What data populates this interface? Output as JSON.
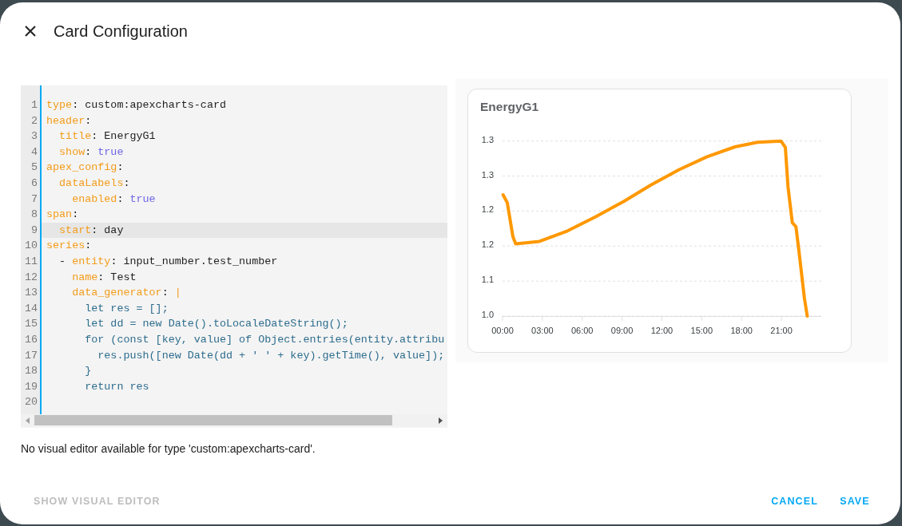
{
  "dialog": {
    "title": "Card Configuration"
  },
  "editor": {
    "lines": [
      {
        "number": "1",
        "active": false,
        "tokens": [
          {
            "kind": "key",
            "text": "type"
          },
          {
            "kind": "plain",
            "text": ": custom:apexcharts-card"
          }
        ]
      },
      {
        "number": "2",
        "active": false,
        "tokens": [
          {
            "kind": "key",
            "text": "header"
          },
          {
            "kind": "plain",
            "text": ":"
          }
        ]
      },
      {
        "number": "3",
        "active": false,
        "tokens": [
          {
            "kind": "key",
            "text": "  title"
          },
          {
            "kind": "plain",
            "text": ": EnergyG1"
          }
        ]
      },
      {
        "number": "4",
        "active": false,
        "tokens": [
          {
            "kind": "key",
            "text": "  show"
          },
          {
            "kind": "plain",
            "text": ": "
          },
          {
            "kind": "bool",
            "text": "true"
          }
        ]
      },
      {
        "number": "5",
        "active": false,
        "tokens": [
          {
            "kind": "key",
            "text": "apex_config"
          },
          {
            "kind": "plain",
            "text": ":"
          }
        ]
      },
      {
        "number": "6",
        "active": false,
        "tokens": [
          {
            "kind": "key",
            "text": "  dataLabels"
          },
          {
            "kind": "plain",
            "text": ":"
          }
        ]
      },
      {
        "number": "7",
        "active": false,
        "tokens": [
          {
            "kind": "key",
            "text": "    enabled"
          },
          {
            "kind": "plain",
            "text": ": "
          },
          {
            "kind": "bool",
            "text": "true"
          }
        ]
      },
      {
        "number": "8",
        "active": false,
        "tokens": [
          {
            "kind": "key",
            "text": "span"
          },
          {
            "kind": "plain",
            "text": ":"
          }
        ]
      },
      {
        "number": "9",
        "active": true,
        "tokens": [
          {
            "kind": "key",
            "text": "  start"
          },
          {
            "kind": "plain",
            "text": ": day"
          }
        ]
      },
      {
        "number": "10",
        "active": false,
        "tokens": [
          {
            "kind": "key",
            "text": "series"
          },
          {
            "kind": "plain",
            "text": ":"
          }
        ]
      },
      {
        "number": "11",
        "active": false,
        "tokens": [
          {
            "kind": "plain",
            "text": "  - "
          },
          {
            "kind": "key",
            "text": "entity"
          },
          {
            "kind": "plain",
            "text": ": input_number.test_number"
          }
        ]
      },
      {
        "number": "12",
        "active": false,
        "tokens": [
          {
            "kind": "key",
            "text": "    name"
          },
          {
            "kind": "plain",
            "text": ": Test"
          }
        ]
      },
      {
        "number": "13",
        "active": false,
        "tokens": [
          {
            "kind": "key",
            "text": "    data_generator"
          },
          {
            "kind": "plain",
            "text": ": "
          },
          {
            "kind": "key",
            "text": "|"
          }
        ]
      },
      {
        "number": "14",
        "active": false,
        "tokens": [
          {
            "kind": "block",
            "text": "      let res = [];"
          }
        ]
      },
      {
        "number": "15",
        "active": false,
        "tokens": [
          {
            "kind": "block",
            "text": "      let dd = new Date().toLocaleDateString();"
          }
        ]
      },
      {
        "number": "16",
        "active": false,
        "tokens": [
          {
            "kind": "block",
            "text": "      for (const [key, value] of Object.entries(entity.attribu"
          }
        ]
      },
      {
        "number": "17",
        "active": false,
        "tokens": [
          {
            "kind": "block",
            "text": "        res.push([new Date(dd + ' ' + key).getTime(), value]);"
          }
        ]
      },
      {
        "number": "18",
        "active": false,
        "tokens": [
          {
            "kind": "block",
            "text": "      }"
          }
        ]
      },
      {
        "number": "19",
        "active": false,
        "tokens": [
          {
            "kind": "block",
            "text": "      return res"
          }
        ]
      },
      {
        "number": "20",
        "active": false
      }
    ]
  },
  "message": "No visual editor available for type 'custom:apexcharts-card'.",
  "preview": {
    "card": {
      "chart_data": {
        "type": "line",
        "title": "EnergyG1",
        "grid": true,
        "x": [
          0.04,
          0.36,
          0.78,
          0.99,
          2.78,
          4.89,
          6.99,
          9.09,
          11.2,
          13.3,
          15.4,
          17.5,
          19.19,
          20.97,
          21.3,
          21.5,
          21.82,
          22.1,
          22.34,
          22.73,
          22.95
        ],
        "series": [
          {
            "color": "#ff9800",
            "values": [
              1.248,
              1.234,
              1.176,
              1.164,
              1.168,
              1.186,
              1.21,
              1.236,
              1.265,
              1.291,
              1.313,
              1.33,
              1.338,
              1.34,
              1.329,
              1.262,
              1.2,
              1.193,
              1.148,
              1.071,
              1.04
            ]
          }
        ],
        "xlim": [
          0,
          24
        ],
        "ylim": [
          1.04,
          1.34
        ],
        "xticks": [
          {
            "value": 0,
            "label": "00:00"
          },
          {
            "value": 3,
            "label": "03:00"
          },
          {
            "value": 6,
            "label": "06:00"
          },
          {
            "value": 9,
            "label": "09:00"
          },
          {
            "value": 12,
            "label": "12:00"
          },
          {
            "value": 15,
            "label": "15:00"
          },
          {
            "value": 18,
            "label": "18:00"
          },
          {
            "value": 21,
            "label": "21:00"
          }
        ],
        "yticks": [
          {
            "value": 1.34,
            "label": "1.3"
          },
          {
            "value": 1.28,
            "label": "1.3"
          },
          {
            "value": 1.22,
            "label": "1.2"
          },
          {
            "value": 1.16,
            "label": "1.2"
          },
          {
            "value": 1.1,
            "label": "1.1"
          },
          {
            "value": 1.04,
            "label": "1.0"
          }
        ]
      }
    }
  },
  "footer": {
    "left_buttons": [
      {
        "label": "SHOW VISUAL EDITOR",
        "disabled": true
      }
    ],
    "right_buttons": [
      {
        "label": "CANCEL",
        "disabled": false
      },
      {
        "label": "SAVE",
        "disabled": false
      }
    ]
  }
}
